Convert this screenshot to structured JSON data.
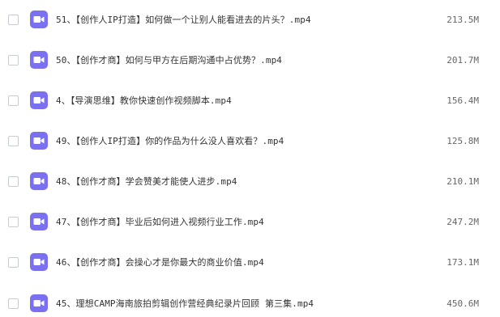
{
  "colors": {
    "video_icon": "#7b71f0",
    "text": "#333333",
    "size_text": "#666666"
  },
  "files": [
    {
      "name": "51、【创作人IP打造】如何做一个让别人能看进去的片头？.mp4",
      "size": "213.5M",
      "icon": "video-file-icon"
    },
    {
      "name": "50、【创作才商】如何与甲方在后期沟通中占优势？.mp4",
      "size": "201.7M",
      "icon": "video-file-icon"
    },
    {
      "name": "4、【导演思维】教你快速创作视频脚本.mp4",
      "size": "156.4M",
      "icon": "video-file-icon"
    },
    {
      "name": "49、【创作人IP打造】你的作品为什么没人喜欢看？.mp4",
      "size": "125.8M",
      "icon": "video-file-icon"
    },
    {
      "name": "48、【创作才商】学会赞美才能使人进步.mp4",
      "size": "210.1M",
      "icon": "video-file-icon"
    },
    {
      "name": "47、【创作才商】毕业后如何进入视频行业工作.mp4",
      "size": "247.2M",
      "icon": "video-file-icon"
    },
    {
      "name": "46、【创作才商】会操心才是你最大的商业价值.mp4",
      "size": "173.1M",
      "icon": "video-file-icon"
    },
    {
      "name": "45、理想CAMP海南旅拍剪辑创作营经典纪录片回顾 第三集.mp4",
      "size": "450.6M",
      "icon": "video-file-icon"
    }
  ]
}
